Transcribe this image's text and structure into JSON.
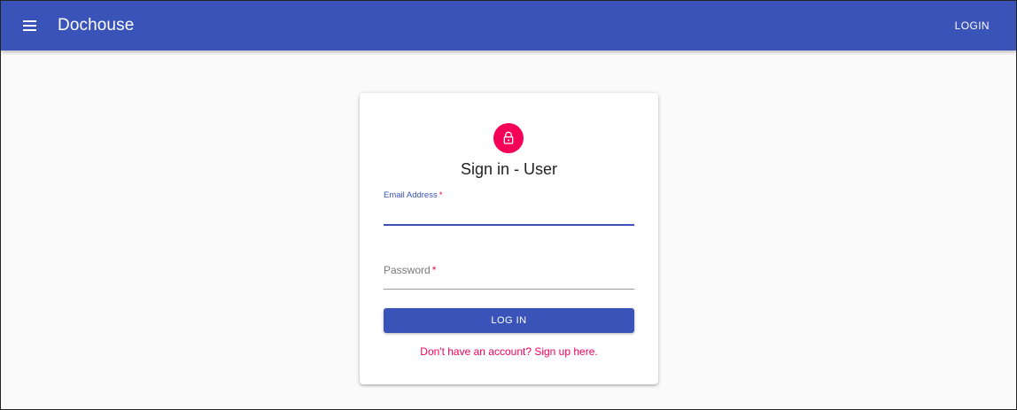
{
  "header": {
    "title": "Dochouse",
    "login_label": "LOGIN"
  },
  "form": {
    "title": "Sign in - User",
    "email": {
      "label": "Email Address",
      "required_mark": "*",
      "value": ""
    },
    "password": {
      "label": "Password",
      "required_mark": "*",
      "value": ""
    },
    "submit_label": "LOG IN",
    "signup_text": "Don't have an account? Sign up here."
  },
  "colors": {
    "primary": "#3a53b8",
    "secondary": "#f50057"
  },
  "icons": {
    "menu": "menu-icon",
    "lock": "lock-icon"
  }
}
